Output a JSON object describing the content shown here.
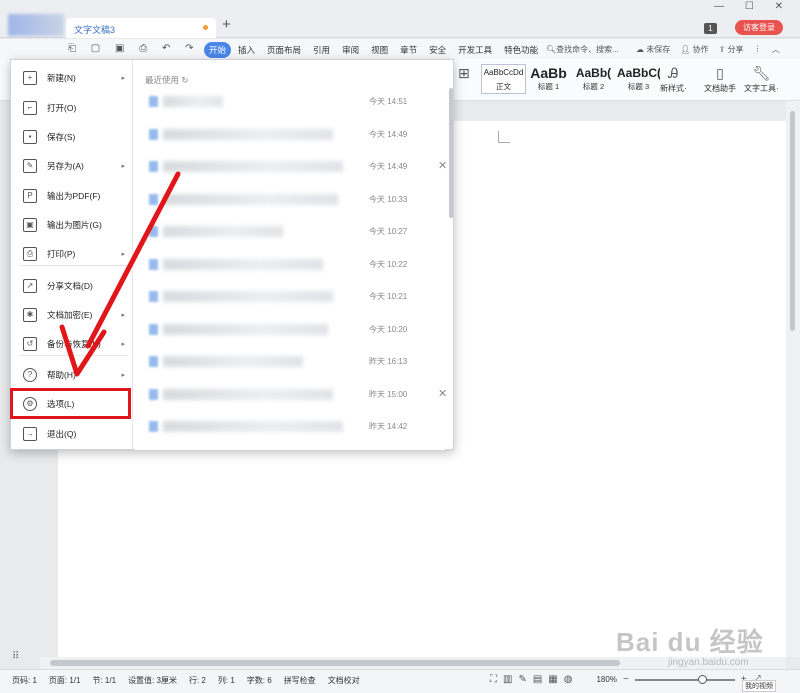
{
  "window": {
    "controls": "— ☐ ✕"
  },
  "tab": {
    "title": "文字文稿3"
  },
  "titlebar": {
    "new_tab": "+",
    "page_badge": "1",
    "visitor_button": "访客登录"
  },
  "quick_access": {
    "icons": "⎗ ▢ ▣ ⎙ ↶ ↷ ▾"
  },
  "menu_tabs": [
    "开始",
    "插入",
    "页面布局",
    "引用",
    "审阅",
    "视图",
    "章节",
    "安全",
    "开发工具",
    "特色功能"
  ],
  "menu_active_index": 0,
  "search": {
    "label": "查找命令、搜索..."
  },
  "right_actions": {
    "unsaved": "未保存",
    "collaborate": "协作",
    "share": "分享"
  },
  "styles": [
    {
      "sample": "AaBbCcDd",
      "name": "正文",
      "size": "small"
    },
    {
      "sample": "AaBb",
      "name": "标题 1",
      "size": "big"
    },
    {
      "sample": "AaBb(",
      "name": "标题 2",
      "size": "mid"
    },
    {
      "sample": "AaBbC(",
      "name": "标题 3",
      "size": "mid"
    }
  ],
  "ribbon_tools": {
    "new_style": "新样式·",
    "doc_helper": "文档助手",
    "text_tools": "文字工具·"
  },
  "file_menu": {
    "items": [
      {
        "label": "新建(N)",
        "icon": "new-doc-icon",
        "arrow": true
      },
      {
        "label": "打开(O)",
        "icon": "open-folder-icon",
        "arrow": false
      },
      {
        "label": "保存(S)",
        "icon": "save-icon",
        "arrow": false
      },
      {
        "label": "另存为(A)",
        "icon": "save-as-icon",
        "arrow": true
      },
      {
        "label": "输出为PDF(F)",
        "icon": "pdf-icon",
        "arrow": false
      },
      {
        "label": "输出为图片(G)",
        "icon": "image-icon",
        "arrow": false
      },
      {
        "label": "打印(P)",
        "icon": "print-icon",
        "arrow": true
      },
      {
        "label": "分享文档(D)",
        "icon": "share-icon",
        "arrow": false
      },
      {
        "label": "文档加密(E)",
        "icon": "encrypt-icon",
        "arrow": true
      },
      {
        "label": "备份与恢复(K)",
        "icon": "backup-icon",
        "arrow": true
      },
      {
        "label": "帮助(H)",
        "icon": "help-icon",
        "arrow": true
      },
      {
        "label": "选项(L)",
        "icon": "gear-icon",
        "arrow": false
      },
      {
        "label": "退出(Q)",
        "icon": "exit-icon",
        "arrow": false
      }
    ],
    "recent_header": "最近使用",
    "recent": [
      {
        "time": "今天 14:51",
        "close": false
      },
      {
        "time": "今天 14:49",
        "close": false
      },
      {
        "time": "今天 14:49",
        "close": true
      },
      {
        "time": "今天 10:33",
        "close": false
      },
      {
        "time": "今天 10:27",
        "close": false
      },
      {
        "time": "今天 10:22",
        "close": false
      },
      {
        "time": "今天 10:21",
        "close": false
      },
      {
        "time": "今天 10:20",
        "close": false
      },
      {
        "time": "昨天 16:13",
        "close": false
      },
      {
        "time": "昨天 15:00",
        "close": true
      },
      {
        "time": "昨天 14:42",
        "close": false
      }
    ]
  },
  "annotation": {
    "highlight_color": "#e0161a"
  },
  "status": {
    "items": [
      "页码: 1",
      "页面: 1/1",
      "节: 1/1",
      "设置值: 3厘米",
      "行: 2",
      "列: 1",
      "字数: 6",
      "拼写检查",
      "文档校对"
    ],
    "zoom": "180%",
    "zoom_level": 0.67,
    "watch_button": "我的视频"
  },
  "watermark": {
    "main": "Bai du 经验",
    "sub": "jingyan.baidu.com"
  }
}
